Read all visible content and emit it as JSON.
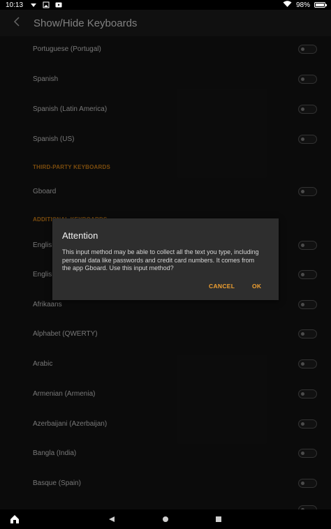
{
  "status_bar": {
    "time": "10:13",
    "battery": "98%",
    "icons": [
      "notification-icon",
      "image-icon",
      "play-icon",
      "wifi-icon",
      "battery-icon"
    ]
  },
  "app_bar": {
    "title": "Show/Hide Keyboards",
    "back_icon": "chevron-left-icon"
  },
  "list": {
    "rows_top": [
      {
        "label": "Portuguese (Portugal)",
        "enabled": false
      },
      {
        "label": "Spanish",
        "enabled": false
      },
      {
        "label": "Spanish (Latin America)",
        "enabled": false
      },
      {
        "label": "Spanish (US)",
        "enabled": false
      }
    ],
    "section_third_party": "THIRD-PARTY KEYBOARDS",
    "third_party_rows": [
      {
        "label": "Gboard",
        "enabled": false
      }
    ],
    "section_additional": "ADDITIONAL KEYBOARDS",
    "additional_rows": [
      {
        "label": "English",
        "enabled": false
      },
      {
        "label": "English",
        "enabled": false
      },
      {
        "label": "Afrikaans",
        "enabled": false
      },
      {
        "label": "Alphabet (QWERTY)",
        "enabled": false
      },
      {
        "label": "Arabic",
        "enabled": false
      },
      {
        "label": "Armenian (Armenia)",
        "enabled": false
      },
      {
        "label": "Azerbaijani (Azerbaijan)",
        "enabled": false
      },
      {
        "label": "Bangla (India)",
        "enabled": false
      },
      {
        "label": "Basque (Spain)",
        "enabled": false
      }
    ]
  },
  "dialog": {
    "title": "Attention",
    "body": "This input method may be able to collect all the text you type, including personal data like passwords and credit card numbers. It comes from the app Gboard. Use this input method?",
    "cancel_label": "CANCEL",
    "ok_label": "OK"
  },
  "nav_bar": {
    "icons": [
      "home-icon",
      "back-icon",
      "home-circle-icon",
      "recents-icon"
    ]
  },
  "colors": {
    "accent": "#f0a030",
    "section": "#e08a19",
    "background": "#151515",
    "dialog": "#2e2e2e"
  }
}
